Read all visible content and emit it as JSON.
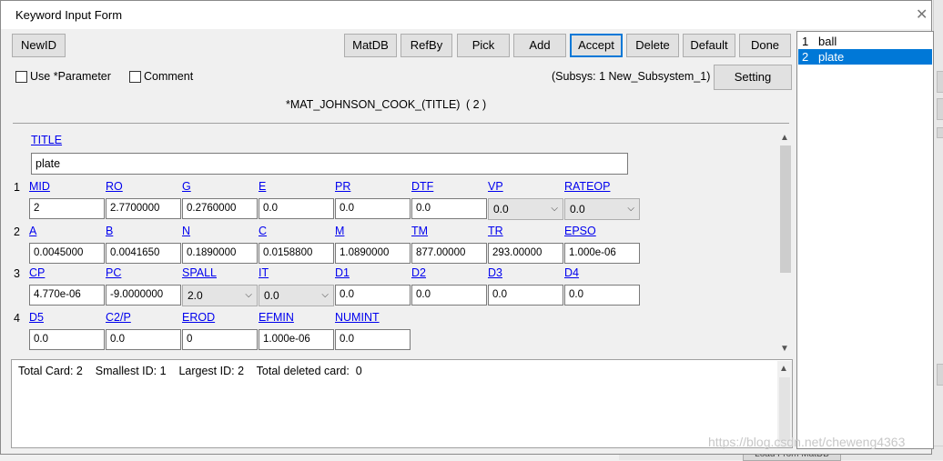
{
  "window": {
    "title": "Keyword Input Form"
  },
  "toolbar": {
    "newid": "NewID",
    "matdb": "MatDB",
    "refby": "RefBy",
    "pick": "Pick",
    "add": "Add",
    "accept": "Accept",
    "delete": "Delete",
    "default": "Default",
    "done": "Done",
    "setting": "Setting"
  },
  "options": {
    "use_parameter": "Use *Parameter",
    "comment": "Comment",
    "subsys": "(Subsys: 1 New_Subsystem_1)"
  },
  "keyword": {
    "header": "*MAT_JOHNSON_COOK_(TITLE)",
    "count": "( 2 )"
  },
  "title_field": {
    "label": "TITLE",
    "value": "plate"
  },
  "rows": [
    {
      "num": "1",
      "fields": [
        {
          "label": "MID",
          "value": "2"
        },
        {
          "label": "RO",
          "value": "2.7700000"
        },
        {
          "label": "G",
          "value": "0.2760000"
        },
        {
          "label": "E",
          "value": "0.0"
        },
        {
          "label": "PR",
          "value": "0.0"
        },
        {
          "label": "DTF",
          "value": "0.0"
        },
        {
          "label": "VP",
          "value": "0.0"
        },
        {
          "label": "RATEOP",
          "value": "0.0"
        }
      ]
    },
    {
      "num": "2",
      "fields": [
        {
          "label": "A",
          "value": "0.0045000"
        },
        {
          "label": "B",
          "value": "0.0041650"
        },
        {
          "label": "N",
          "value": "0.1890000"
        },
        {
          "label": "C",
          "value": "0.0158800"
        },
        {
          "label": "M",
          "value": "1.0890000"
        },
        {
          "label": "TM",
          "value": "877.00000"
        },
        {
          "label": "TR",
          "value": "293.00000"
        },
        {
          "label": "EPSO",
          "value": "1.000e-06"
        }
      ]
    },
    {
      "num": "3",
      "fields": [
        {
          "label": "CP",
          "value": "4.770e-06"
        },
        {
          "label": "PC",
          "value": "-9.0000000"
        },
        {
          "label": "SPALL",
          "value": "2.0"
        },
        {
          "label": "IT",
          "value": "0.0"
        },
        {
          "label": "D1",
          "value": "0.0"
        },
        {
          "label": "D2",
          "value": "0.0"
        },
        {
          "label": "D3",
          "value": "0.0"
        },
        {
          "label": "D4",
          "value": "0.0"
        }
      ]
    },
    {
      "num": "4",
      "fields": [
        {
          "label": "D5",
          "value": "0.0"
        },
        {
          "label": "C2/P",
          "value": "0.0"
        },
        {
          "label": "EROD",
          "value": "0"
        },
        {
          "label": "EFMIN",
          "value": "1.000e-06"
        },
        {
          "label": "NUMINT",
          "value": "0.0"
        }
      ]
    }
  ],
  "info": {
    "text": "Total Card: 2    Smallest ID: 1    Largest ID: 2    Total deleted card:  0"
  },
  "list": [
    {
      "num": "1",
      "name": "ball",
      "selected": false
    },
    {
      "num": "2",
      "name": "plate",
      "selected": true
    }
  ],
  "background": {
    "button_label": "Load From MatDB",
    "watermark": "https://blog.csdn.net/cheweng4363"
  },
  "colors": {
    "link": "#0000ee",
    "selection": "#0078d7",
    "focus_border": "#0078d7"
  }
}
